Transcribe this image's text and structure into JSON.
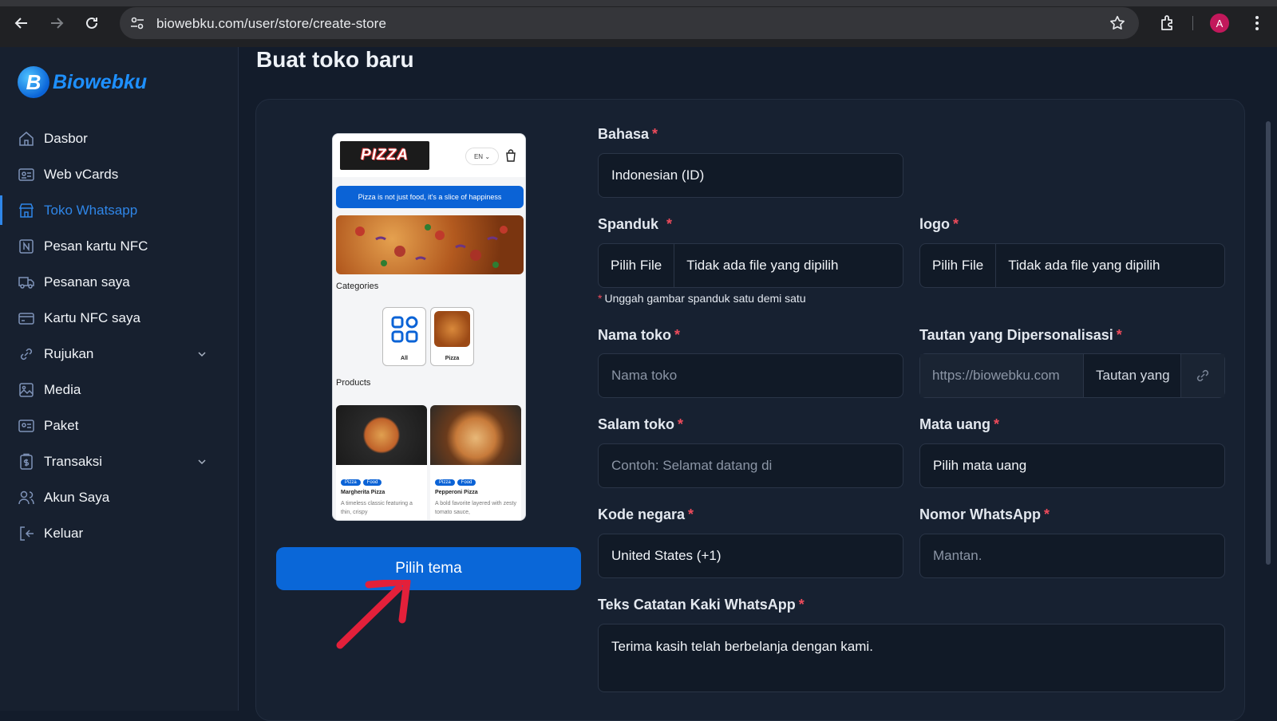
{
  "browser": {
    "url": "biowebku.com/user/store/create-store",
    "profile_initial": "A"
  },
  "sidebar": {
    "brand": "Biowebku",
    "items": [
      {
        "label": "Dasbor"
      },
      {
        "label": "Web vCards"
      },
      {
        "label": "Toko Whatsapp",
        "active": true
      },
      {
        "label": "Pesan kartu NFC"
      },
      {
        "label": "Pesanan saya"
      },
      {
        "label": "Kartu NFC saya"
      },
      {
        "label": "Rujukan",
        "has_dropdown": true
      },
      {
        "label": "Media"
      },
      {
        "label": "Paket"
      },
      {
        "label": "Transaksi",
        "has_dropdown": true
      },
      {
        "label": "Akun Saya"
      },
      {
        "label": "Keluar"
      }
    ]
  },
  "page": {
    "title": "Buat toko baru",
    "theme_button": "Pilih tema"
  },
  "preview": {
    "logo_text": "PIZZA",
    "lang": "EN",
    "banner": "Pizza is not just food, it's a slice of happiness",
    "categories_title": "Categories",
    "categories": [
      "All",
      "Pizza"
    ],
    "products_title": "Products",
    "products": [
      {
        "tags": [
          "Pizza",
          "Food"
        ],
        "name": "Margherita Pizza",
        "desc": "A timeless classic featuring a thin, crispy"
      },
      {
        "tags": [
          "Pizza",
          "Food"
        ],
        "name": "Pepperoni Pizza",
        "desc": "A bold favorite layered with zesty tomato sauce,"
      }
    ]
  },
  "form": {
    "bahasa": {
      "label": "Bahasa",
      "value": "Indonesian (ID)"
    },
    "spanduk": {
      "label": "Spanduk",
      "button": "Pilih File",
      "status": "Tidak ada file yang dipilih",
      "hint": "Unggah gambar spanduk satu demi satu"
    },
    "logo": {
      "label": "logo",
      "button": "Pilih File",
      "status": "Tidak ada file yang dipilih"
    },
    "nama_toko": {
      "label": "Nama toko",
      "placeholder": "Nama toko"
    },
    "tautan": {
      "label": "Tautan yang Dipersonalisasi",
      "prefix": "https://biowebku.com",
      "placeholder": "Tautan yang"
    },
    "salam_toko": {
      "label": "Salam toko",
      "placeholder": "Contoh: Selamat datang di"
    },
    "mata_uang": {
      "label": "Mata uang",
      "value": "Pilih mata uang"
    },
    "kode_negara": {
      "label": "Kode negara",
      "value": "United States (+1)"
    },
    "nomor_whatsapp": {
      "label": "Nomor WhatsApp",
      "placeholder": "Mantan."
    },
    "footer_text": {
      "label": "Teks Catatan Kaki WhatsApp",
      "value": "Terima kasih telah berbelanja dengan kami."
    },
    "required_mark": "*"
  },
  "colors": {
    "accent": "#0a67d8",
    "active_menu": "#2f86e8",
    "required": "#ee4b5b",
    "annotation_arrow": "#e3203a"
  }
}
